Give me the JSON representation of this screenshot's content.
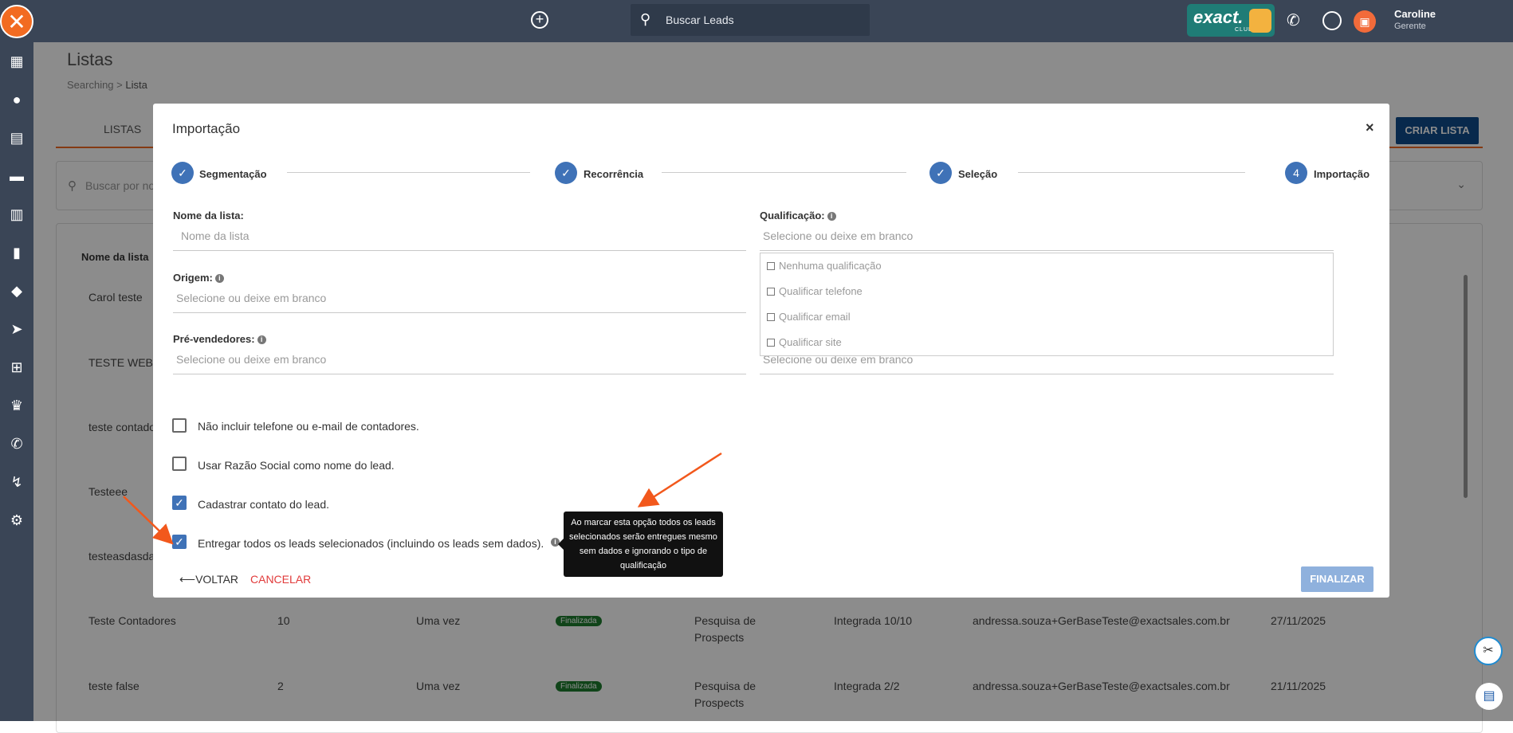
{
  "topbar": {
    "search_placeholder": "Buscar Leads",
    "brand_word": "exact.",
    "brand_sub": "CLUB",
    "user_name": "Caroline",
    "user_role": "Gerente"
  },
  "page": {
    "title": "Listas",
    "breadcrumb_parent": "Searching",
    "breadcrumb_sep": ">",
    "breadcrumb_current": "Lista",
    "tab_label": "LISTAS",
    "create_button": "CRIAR LISTA",
    "search_placeholder": "Buscar por no",
    "column_header": "Nome da lista",
    "rows": [
      {
        "name": "Carol teste"
      },
      {
        "name": "TESTE WEBH"
      },
      {
        "name": "teste contado"
      },
      {
        "name": "Testeee"
      },
      {
        "name": "testeasdasda"
      },
      {
        "name": "Teste Contadores",
        "count": "10",
        "recurrence": "Uma vez",
        "status": "Finalizada",
        "origin1": "Pesquisa de",
        "origin2": "Prospects",
        "integration": "Integrada 10/10",
        "user": "andressa.souza+GerBaseTeste@exactsales.com.br",
        "date": "27/11/2025"
      },
      {
        "name": "teste false",
        "count": "2",
        "recurrence": "Uma vez",
        "status": "Finalizada",
        "origin1": "Pesquisa de",
        "origin2": "Prospects",
        "integration": "Integrada 2/2",
        "user": "andressa.souza+GerBaseTeste@exactsales.com.br",
        "date": "21/11/2025"
      }
    ]
  },
  "modal": {
    "title": "Importação",
    "close": "×",
    "steps": [
      {
        "label": "Segmentação",
        "state": "done"
      },
      {
        "label": "Recorrência",
        "state": "done"
      },
      {
        "label": "Seleção",
        "state": "done"
      },
      {
        "label": "Importação",
        "number": "4",
        "state": "active"
      }
    ],
    "fields": {
      "list_name_label": "Nome da lista:",
      "list_name_placeholder": "Nome da lista",
      "origin_label": "Origem:",
      "origin_placeholder": "Selecione ou deixe em branco",
      "presellers_label": "Pré-vendedores:",
      "presellers_placeholder": "Selecione ou deixe em branco",
      "qualification_label": "Qualificação:",
      "qualification_placeholder": "Selecione ou deixe em branco",
      "below_placeholder": "Selecione ou deixe em branco"
    },
    "qualification_options": [
      "Nenhuma qualificação",
      "Qualificar telefone",
      "Qualificar email",
      "Qualificar site"
    ],
    "checkboxes": [
      {
        "label": "Não incluir telefone ou e-mail de contadores.",
        "checked": false
      },
      {
        "label": "Usar Razão Social como nome do lead.",
        "checked": false
      },
      {
        "label": "Cadastrar contato do lead.",
        "checked": true
      },
      {
        "label": "Entregar todos os leads selecionados (incluindo os leads sem dados).",
        "checked": true
      }
    ],
    "tooltip": "Ao marcar esta opção todos os leads selecionados serão entregues mesmo sem dados e ignorando o tipo de qualificação",
    "back_button": "VOLTAR",
    "cancel_button": "CANCELAR",
    "finish_button": "FINALIZAR"
  },
  "colors": {
    "topbar": "#3a4556",
    "accent": "#f26b21",
    "primary": "#3f72b7",
    "annotation_arrow": "#f2581c"
  },
  "icons": [
    "logo-icon",
    "plus-circle-icon",
    "search-icon",
    "phone-icon",
    "whatsapp-icon",
    "avatar-icon",
    "dashboard-icon",
    "person-icon",
    "contact-card-icon",
    "briefcase-icon",
    "building-icon",
    "chart-icon",
    "tag-icon",
    "send-icon",
    "flow-icon",
    "trophy-icon",
    "phone-icon",
    "route-icon",
    "gear-icon",
    "check-icon",
    "info-icon",
    "arrow-left-icon",
    "chat-icon"
  ]
}
